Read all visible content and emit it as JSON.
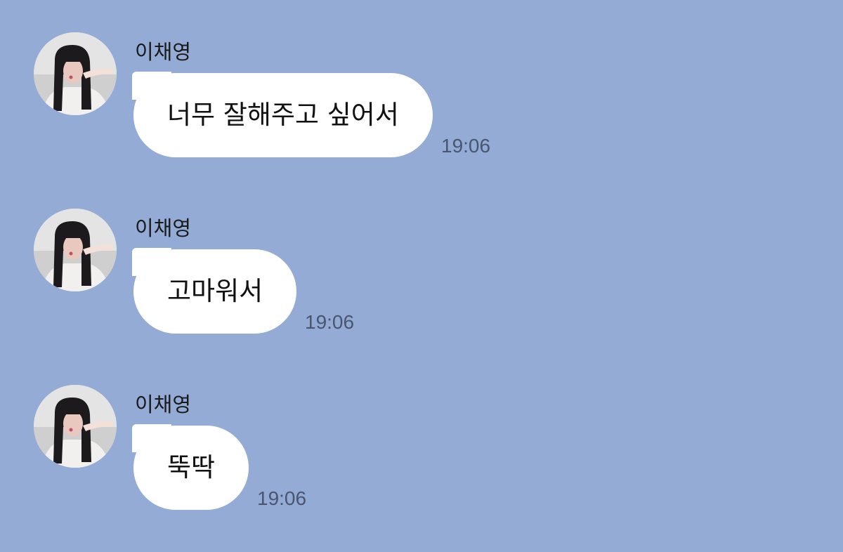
{
  "conversation": {
    "messages": [
      {
        "sender": "이채영",
        "text": "너무 잘해주고 싶어서",
        "time": "19:06",
        "avatar_icon": "profile-photo"
      },
      {
        "sender": "이채영",
        "text": "고마워서",
        "time": "19:06",
        "avatar_icon": "profile-photo"
      },
      {
        "sender": "이채영",
        "text": "뚝딱",
        "time": "19:06",
        "avatar_icon": "profile-photo"
      }
    ]
  },
  "colors": {
    "background": "#93abd5",
    "bubble": "#ffffff",
    "timestamp": "#4a5670"
  }
}
